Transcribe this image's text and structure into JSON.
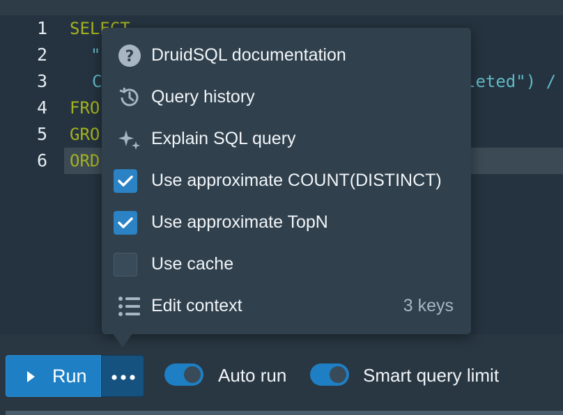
{
  "editor": {
    "line_numbers": [
      "1",
      "2",
      "3",
      "4",
      "5",
      "6"
    ],
    "lines": {
      "l1": {
        "kw": "SELECT"
      },
      "l2": {
        "str": "\""
      },
      "l3": {
        "str_a": "C",
        "str_b": "leted\") /"
      },
      "l4": {
        "kw": "FRO"
      },
      "l5": {
        "kw": "GRO"
      },
      "l6": {
        "kw": "ORD"
      }
    }
  },
  "menu": {
    "items": [
      {
        "label": "DruidSQL documentation",
        "icon": "help-circle-icon"
      },
      {
        "label": "Query history",
        "icon": "history-icon"
      },
      {
        "label": "Explain SQL query",
        "icon": "sparkles-icon"
      },
      {
        "label": "Use approximate COUNT(DISTINCT)",
        "checked": true
      },
      {
        "label": "Use approximate TopN",
        "checked": true
      },
      {
        "label": "Use cache",
        "checked": false
      },
      {
        "label": "Edit context",
        "icon": "list-icon",
        "meta": "3 keys"
      }
    ]
  },
  "toolbar": {
    "run_label": "Run",
    "auto_run_label": "Auto run",
    "auto_run_on": true,
    "smart_limit_label": "Smart query limit",
    "smart_limit_on": true
  },
  "colors": {
    "background": "#293742",
    "popover": "#30404d",
    "accent": "#1f7fc4",
    "keyword": "#a4b11e",
    "string": "#5fb9c4"
  }
}
